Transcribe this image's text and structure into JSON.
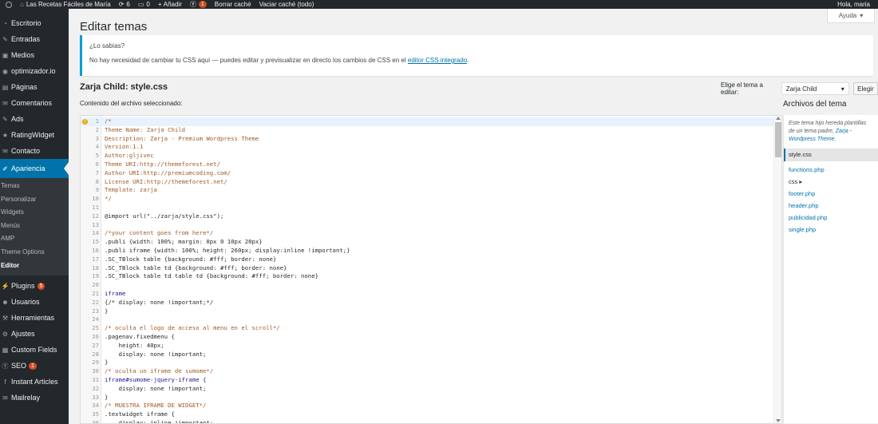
{
  "adminbar": {
    "site_name": "Las Recetas Fáciles de María",
    "updates_count": "6",
    "comments_count": "0",
    "add_label": "Añadir",
    "yoast_count": "1",
    "clear_cache": "Borrar caché",
    "empty_cache": "Vaciar caché (todo)",
    "greeting": "Hola, maria"
  },
  "sidebar": {
    "items_top": [
      {
        "label": "Escritorio",
        "icon": "dashboard-icon",
        "glyph": "◔"
      },
      {
        "label": "Entradas",
        "icon": "pin-icon",
        "glyph": "✎"
      },
      {
        "label": "Medios",
        "icon": "media-icon",
        "glyph": "▣"
      },
      {
        "label": "optimizador.io",
        "icon": "gauge-icon",
        "glyph": "◉"
      },
      {
        "label": "Páginas",
        "icon": "page-icon",
        "glyph": "▤"
      },
      {
        "label": "Comentarios",
        "icon": "comments-icon",
        "glyph": "✉"
      },
      {
        "label": "Ads",
        "icon": "pin-icon",
        "glyph": "✎"
      },
      {
        "label": "RatingWidget",
        "icon": "star-icon",
        "glyph": "★"
      },
      {
        "label": "Contacto",
        "icon": "mail-icon",
        "glyph": "✉"
      }
    ],
    "current": {
      "label": "Apariencia",
      "icon": "brush-icon",
      "glyph": "✐"
    },
    "submenu": [
      "Temas",
      "Personalizar",
      "Widgets",
      "Menús",
      "AMP",
      "Theme Options",
      "Editor"
    ],
    "items_bottom": [
      {
        "label": "Plugins",
        "icon": "plugin-icon",
        "glyph": "⚡",
        "count": "5"
      },
      {
        "label": "Usuarios",
        "icon": "user-icon",
        "glyph": "☻"
      },
      {
        "label": "Herramientas",
        "icon": "wrench-icon",
        "glyph": "⚒"
      },
      {
        "label": "Ajustes",
        "icon": "settings-icon",
        "glyph": "⚙"
      },
      {
        "label": "Custom Fields",
        "icon": "fields-icon",
        "glyph": "▦"
      },
      {
        "label": "SEO",
        "icon": "yoast-icon",
        "glyph": "Ⓨ",
        "count": "1"
      },
      {
        "label": "Instant Articles",
        "icon": "facebook-icon",
        "glyph": "f"
      },
      {
        "label": "Mailrelay",
        "icon": "mail-icon",
        "glyph": "✉"
      }
    ]
  },
  "help_label": "Ayuda",
  "page_title": "Editar temas",
  "notice": {
    "heading": "¿Lo sabías?",
    "text": "No hay necesidad de cambiar tu CSS aquí — puedes editar y previsualizar en directo los cambios de CSS en el",
    "link": "editor CSS integrado",
    "end": "."
  },
  "file_title": "Zarja Child: style.css",
  "theme_select": {
    "label": "Elige el tema a editar:",
    "value": "Zarja Child",
    "button": "Elegir"
  },
  "content_label": "Contenido del archivo seleccionado:",
  "code": [
    {
      "n": "1",
      "t": "/*",
      "c": "comment"
    },
    {
      "n": "2",
      "t": "Theme Name: Zarja Child",
      "c": "comment"
    },
    {
      "n": "3",
      "t": "Description: Zarja - Premium Wordpress Theme",
      "c": "comment"
    },
    {
      "n": "4",
      "t": "Version:1.1",
      "c": "comment"
    },
    {
      "n": "5",
      "t": "Author:gljivec",
      "c": "comment"
    },
    {
      "n": "6",
      "t": "Theme URI:http://themeforest.net/",
      "c": "comment"
    },
    {
      "n": "7",
      "t": "Author URI:http://premiumcoding.com/",
      "c": "comment"
    },
    {
      "n": "8",
      "t": "License URI:http://themeforest.net/",
      "c": "comment"
    },
    {
      "n": "9",
      "t": "Template: zarja",
      "c": "comment"
    },
    {
      "n": "10",
      "t": "*/",
      "c": "comment"
    },
    {
      "n": "11",
      "t": "",
      "c": "def"
    },
    {
      "n": "12",
      "t": "@import url(\"../zarja/style.css\");",
      "c": "def"
    },
    {
      "n": "13",
      "t": "",
      "c": "def"
    },
    {
      "n": "14",
      "t": "/*your content goes from here*/",
      "c": "comment"
    },
    {
      "n": "15",
      "t": ".publi {width: 100%; margin: 0px 0 10px 20px}",
      "c": "def"
    },
    {
      "n": "16",
      "t": ".publi iframe {width: 100%; height: 260px; display:inline !important;}",
      "c": "def",
      "warn": true
    },
    {
      "n": "17",
      "t": ".SC_TBlock table {background: #fff; border: none}",
      "c": "def"
    },
    {
      "n": "18",
      "t": ".SC_TBlock table td {background: #fff; border: none}",
      "c": "def"
    },
    {
      "n": "19",
      "t": ".SC_TBlock table td table td {background: #fff; border: none}",
      "c": "def"
    },
    {
      "n": "20",
      "t": "",
      "c": "def"
    },
    {
      "n": "21",
      "t": "iframe",
      "c": "sel"
    },
    {
      "n": "22",
      "t": "{/* display: none !important;*/",
      "c": "def"
    },
    {
      "n": "23",
      "t": "}",
      "c": "def"
    },
    {
      "n": "24",
      "t": "",
      "c": "def"
    },
    {
      "n": "25",
      "t": "/* oculta el logo de acceso al menu en el scroll*/",
      "c": "comment"
    },
    {
      "n": "26",
      "t": ".pagenav.fixedmenu {",
      "c": "def"
    },
    {
      "n": "27",
      "t": "    height: 40px;",
      "c": "def"
    },
    {
      "n": "28",
      "t": "    display: none !important;",
      "c": "def"
    },
    {
      "n": "29",
      "t": "}",
      "c": "def"
    },
    {
      "n": "30",
      "t": "/* oculta un iframe de sumome*/",
      "c": "comment"
    },
    {
      "n": "31",
      "t": "iframe#sumome-jquery-iframe {",
      "c": "sel"
    },
    {
      "n": "32",
      "t": "    display: none !important;",
      "c": "def"
    },
    {
      "n": "33",
      "t": "}",
      "c": "def"
    },
    {
      "n": "34",
      "t": "/* MUESTRA IFRAME DE WIDGET*/",
      "c": "comment"
    },
    {
      "n": "35",
      "t": ".textwidget iframe {",
      "c": "def"
    },
    {
      "n": "36",
      "t": "    display: inline !important;",
      "c": "def"
    }
  ],
  "files": {
    "title": "Archivos del tema",
    "desc": "Este tema hijo hereda plantillas de un tema padre,",
    "parent": "Zarja - Wordpress Theme",
    "list": [
      {
        "name": "style.css",
        "current": true
      },
      {
        "name": "functions.php"
      },
      {
        "name": "css ▸",
        "dir": true
      },
      {
        "name": "footer.php"
      },
      {
        "name": "header.php"
      },
      {
        "name": "publicidad.php"
      },
      {
        "name": "single.php"
      }
    ]
  }
}
